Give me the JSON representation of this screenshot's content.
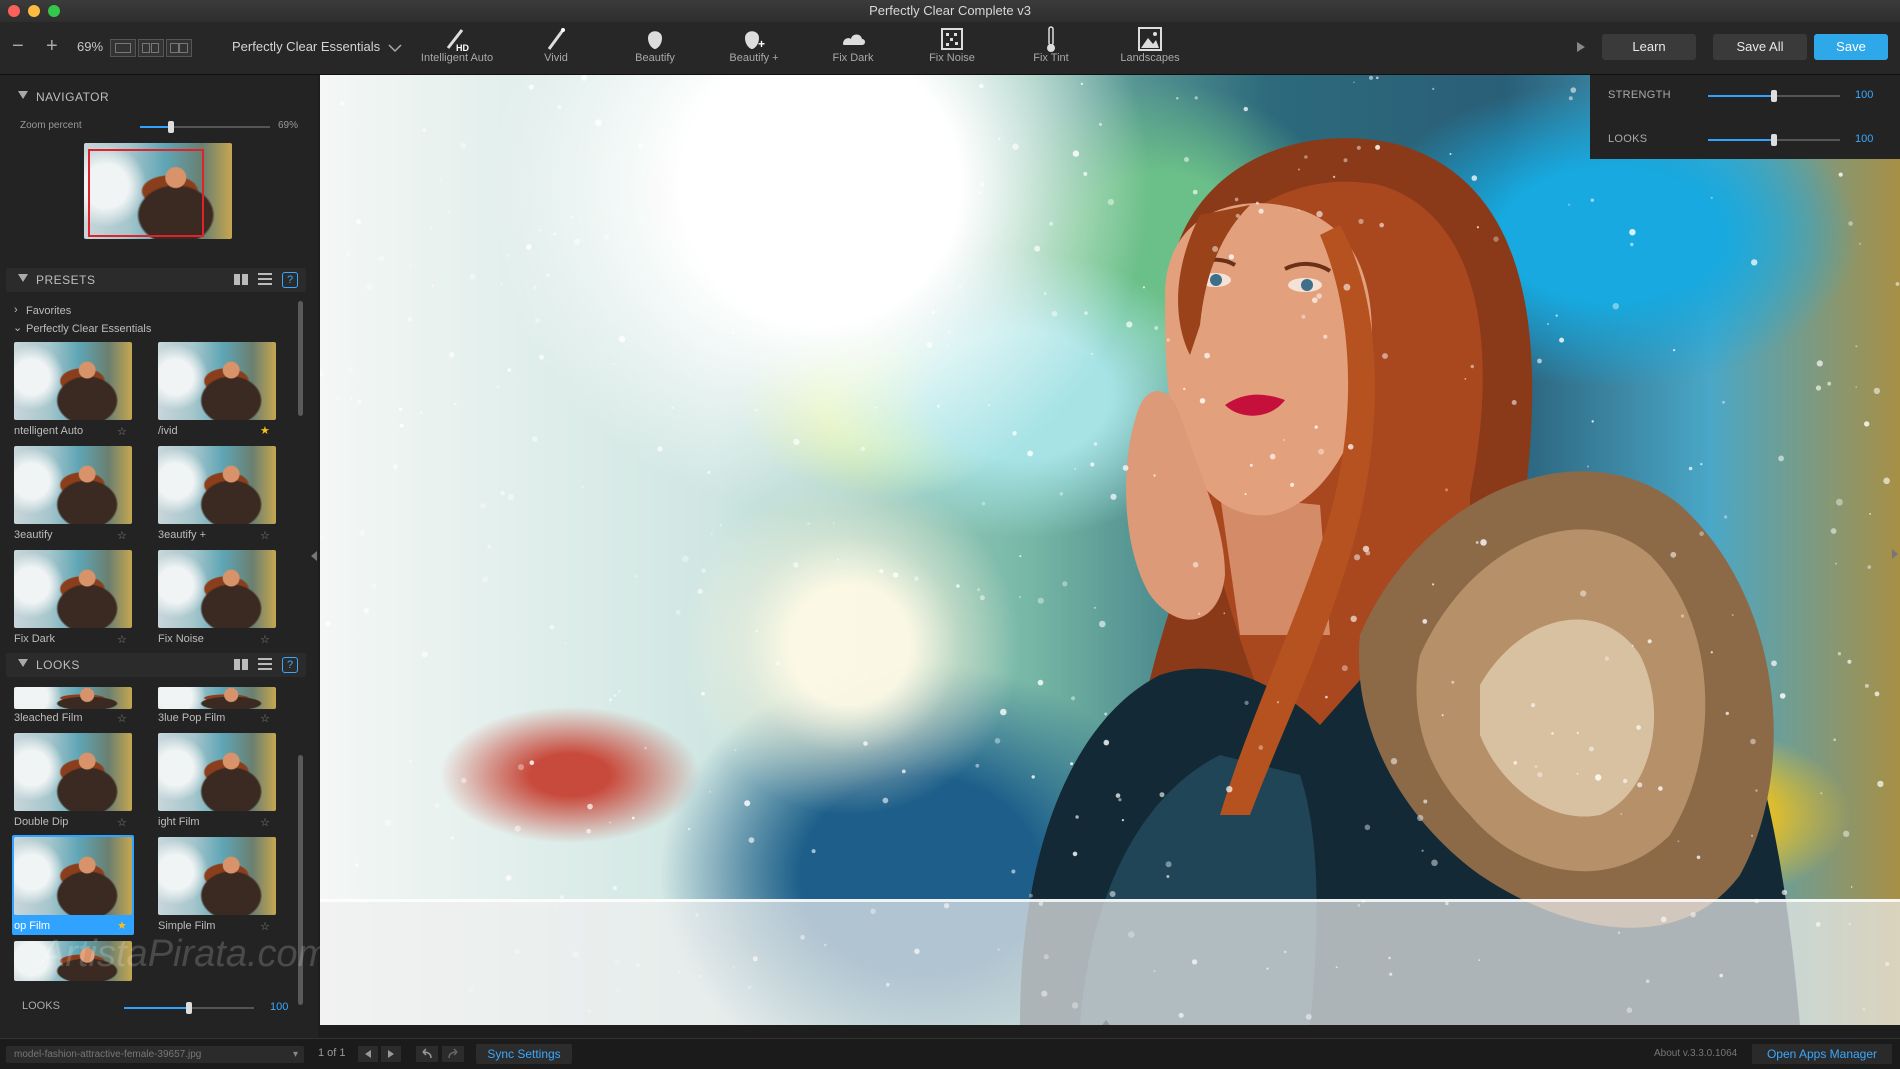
{
  "window": {
    "title": "Perfectly Clear Complete v3"
  },
  "toolbar": {
    "zoom_out": "−",
    "zoom_in": "+",
    "zoom_value": "69%",
    "preset_dropdown": "Perfectly Clear Essentials",
    "tools": [
      {
        "label": "Intelligent Auto",
        "icon": "wand-hd-icon"
      },
      {
        "label": "Vivid",
        "icon": "wand-icon"
      },
      {
        "label": "Beautify",
        "icon": "face-icon"
      },
      {
        "label": "Beautify +",
        "icon": "face-plus-icon"
      },
      {
        "label": "Fix Dark",
        "icon": "cloud-icon"
      },
      {
        "label": "Fix Noise",
        "icon": "noise-icon"
      },
      {
        "label": "Fix Tint",
        "icon": "thermometer-icon"
      },
      {
        "label": "Landscapes",
        "icon": "landscape-icon"
      }
    ],
    "learn": "Learn",
    "save_all": "Save All",
    "save": "Save"
  },
  "navigator": {
    "title": "NAVIGATOR",
    "zoom_label": "Zoom percent",
    "zoom_value": "69%",
    "zoom_level": 0.69
  },
  "presets": {
    "title": "PRESETS",
    "help": "?",
    "favorites": "Favorites",
    "group": "Perfectly Clear Essentials",
    "items": [
      {
        "label": "ntelligent Auto",
        "starred": false
      },
      {
        "label": "/ivid",
        "starred": true
      },
      {
        "label": "3eautify",
        "starred": false
      },
      {
        "label": "3eautify +",
        "starred": false
      },
      {
        "label": "Fix Dark",
        "starred": false
      },
      {
        "label": "Fix Noise",
        "starred": false
      }
    ]
  },
  "looks": {
    "title": "LOOKS",
    "help": "?",
    "items": [
      {
        "label": "3leached Film",
        "starred": false
      },
      {
        "label": "3lue Pop Film",
        "starred": false
      },
      {
        "label": "Double Dip",
        "starred": false
      },
      {
        "label": "ight Film",
        "starred": false
      },
      {
        "label": "op Film",
        "starred": true,
        "selected": true
      },
      {
        "label": "Simple Film",
        "starred": false
      }
    ],
    "slider_label": "LOOKS",
    "slider_value": "100",
    "slider_level": 0.5
  },
  "right_panel": {
    "strength_label": "STRENGTH",
    "strength_value": "100",
    "strength_level": 0.5,
    "looks_label": "LOOKS",
    "looks_value": "100",
    "looks_level": 0.5
  },
  "watermark": "ArtistaPirata.com",
  "statusbar": {
    "filename": "model-fashion-attractive-female-39657.jpg",
    "page": "1 of 1",
    "sync": "Sync Settings",
    "about": "About v.3.3.0.1064",
    "open_apps": "Open Apps Manager"
  },
  "colors": {
    "accent": "#2fa3ff",
    "save_button": "#2ea8e8",
    "star_on": "#f3c21a",
    "background": "#1e1e1e"
  }
}
